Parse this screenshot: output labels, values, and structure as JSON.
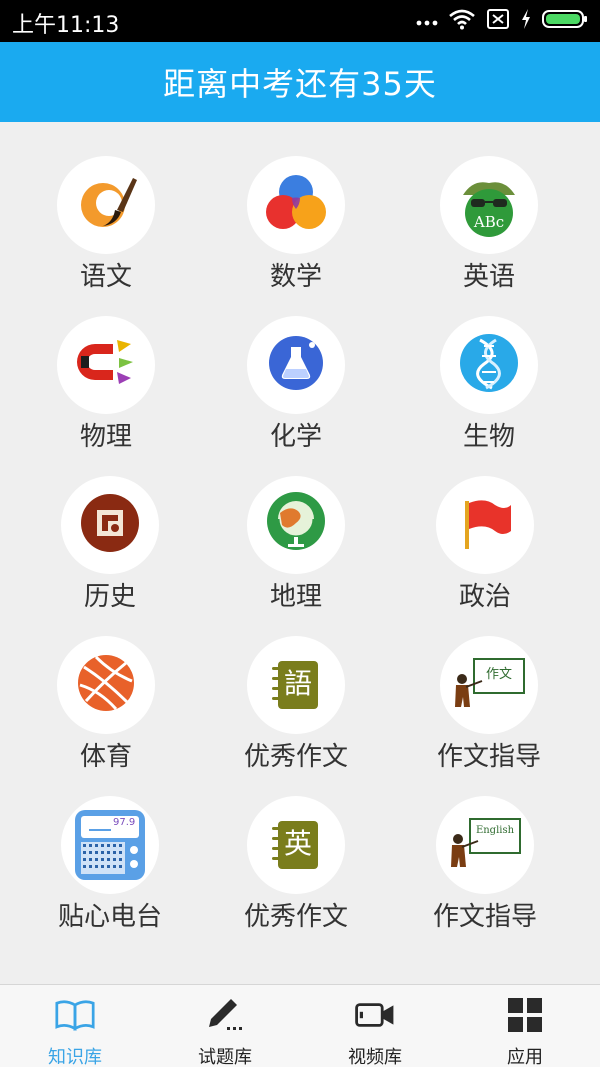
{
  "status_bar": {
    "time": "上午11:13",
    "icons": [
      "more-dots-icon",
      "wifi-icon",
      "no-sim-icon",
      "charging-icon",
      "battery-icon"
    ]
  },
  "header": {
    "title": "距离中考还有35天"
  },
  "subjects": [
    {
      "label": "语文",
      "icon": "brush-icon"
    },
    {
      "label": "数学",
      "icon": "circles-icon"
    },
    {
      "label": "英语",
      "icon": "abc-icon",
      "icon_text": "ABc"
    },
    {
      "label": "物理",
      "icon": "magnet-icon"
    },
    {
      "label": "化学",
      "icon": "flask-icon"
    },
    {
      "label": "生物",
      "icon": "dna-icon"
    },
    {
      "label": "历史",
      "icon": "seal-icon"
    },
    {
      "label": "地理",
      "icon": "globe-icon"
    },
    {
      "label": "政治",
      "icon": "flag-icon"
    },
    {
      "label": "体育",
      "icon": "basketball-icon"
    },
    {
      "label": "优秀作文",
      "icon": "chinese-notebook-icon",
      "icon_text": "語"
    },
    {
      "label": "作文指导",
      "icon": "teacher-board-icon",
      "icon_text": "作文"
    },
    {
      "label": "贴心电台",
      "icon": "radio-icon",
      "icon_text": "97.9"
    },
    {
      "label": "优秀作文",
      "icon": "english-notebook-icon",
      "icon_text": "英"
    },
    {
      "label": "作文指导",
      "icon": "teacher-board-icon",
      "icon_text": "English"
    }
  ],
  "bottom_nav": [
    {
      "label": "知识库",
      "icon": "book-icon",
      "active": true
    },
    {
      "label": "试题库",
      "icon": "pencil-icon",
      "active": false
    },
    {
      "label": "视频库",
      "icon": "video-camera-icon",
      "active": false
    },
    {
      "label": "应用",
      "icon": "apps-grid-icon",
      "active": false
    }
  ],
  "colors": {
    "header_bg": "#1aaaf0",
    "active_tab": "#3aa4e6",
    "background": "#efefef"
  }
}
